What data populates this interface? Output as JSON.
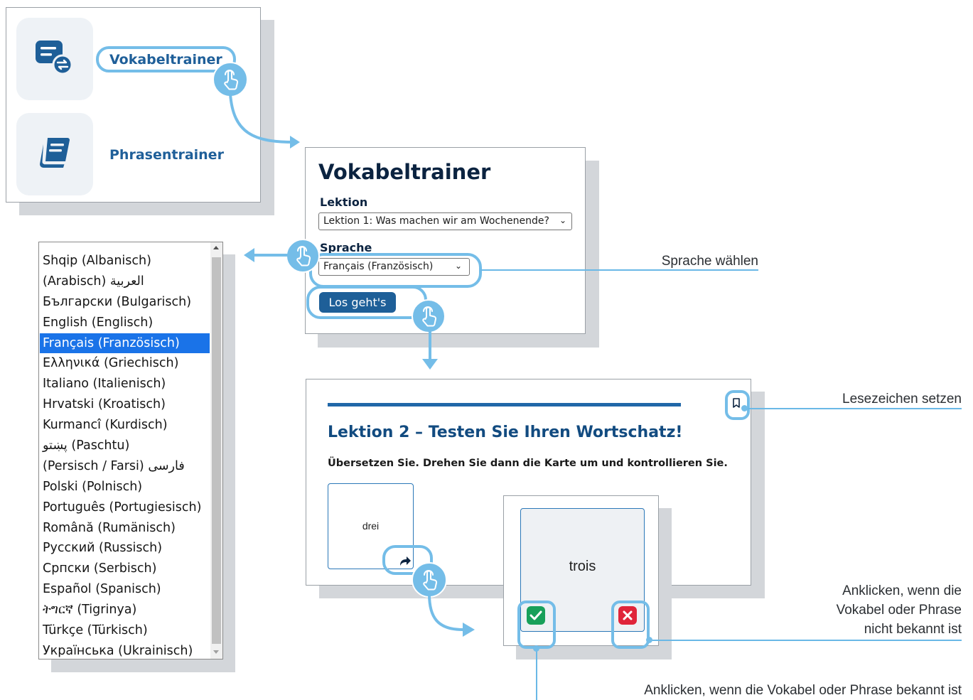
{
  "menu": {
    "items": [
      {
        "label": "Vokabeltrainer",
        "icon": "swap-list-icon"
      },
      {
        "label": "Phrasentrainer",
        "icon": "book-icon"
      }
    ]
  },
  "trainer": {
    "title": "Vokabeltrainer",
    "lesson_label": "Lektion",
    "lesson_value": "Lektion 1: Was machen wir am Wochenende?",
    "language_label": "Sprache",
    "language_value": "Français (Französisch)",
    "start_button": "Los geht's"
  },
  "language_list": {
    "selected": "Français (Französisch)",
    "options": [
      "Shqip (Albanisch)",
      "(Arabisch) العربية",
      "Български (Bulgarisch)",
      "English (Englisch)",
      "Français (Französisch)",
      "Ελληνικά (Griechisch)",
      "Italiano (Italienisch)",
      "Hrvatski (Kroatisch)",
      "Kurmancî (Kurdisch)",
      "پښتو (Paschtu)",
      "(Persisch / Farsi) فارسی",
      "Polski (Polnisch)",
      "Português (Portugiesisch)",
      "Română (Rumänisch)",
      "Русский (Russisch)",
      "Српски (Serbisch)",
      "Español (Spanisch)",
      "ትግርኛ (Tigrinya)",
      "Türkçe (Türkisch)",
      "Українська (Ukrainisch)"
    ]
  },
  "lesson": {
    "title": "Lektion 2 – Testen Sie Ihren Wortschatz!",
    "instruction": "Übersetzen Sie. Drehen Sie dann die Karte um und kontrollieren Sie.",
    "front_word": "drei",
    "back_word": "trois"
  },
  "annotations": {
    "choose_language": "Sprache wählen",
    "set_bookmark": "Lesezeichen setzen",
    "unknown": "Anklicken, wenn die Vokabel oder Phrase nicht bekannt ist",
    "known": "Anklicken, wenn die Vokabel oder Phrase bekannt ist"
  },
  "colors": {
    "accent": "#74bde8",
    "primary": "#1e5f98",
    "title": "#0b2340",
    "known_green": "#18a05a",
    "unknown_red": "#e0253a"
  }
}
